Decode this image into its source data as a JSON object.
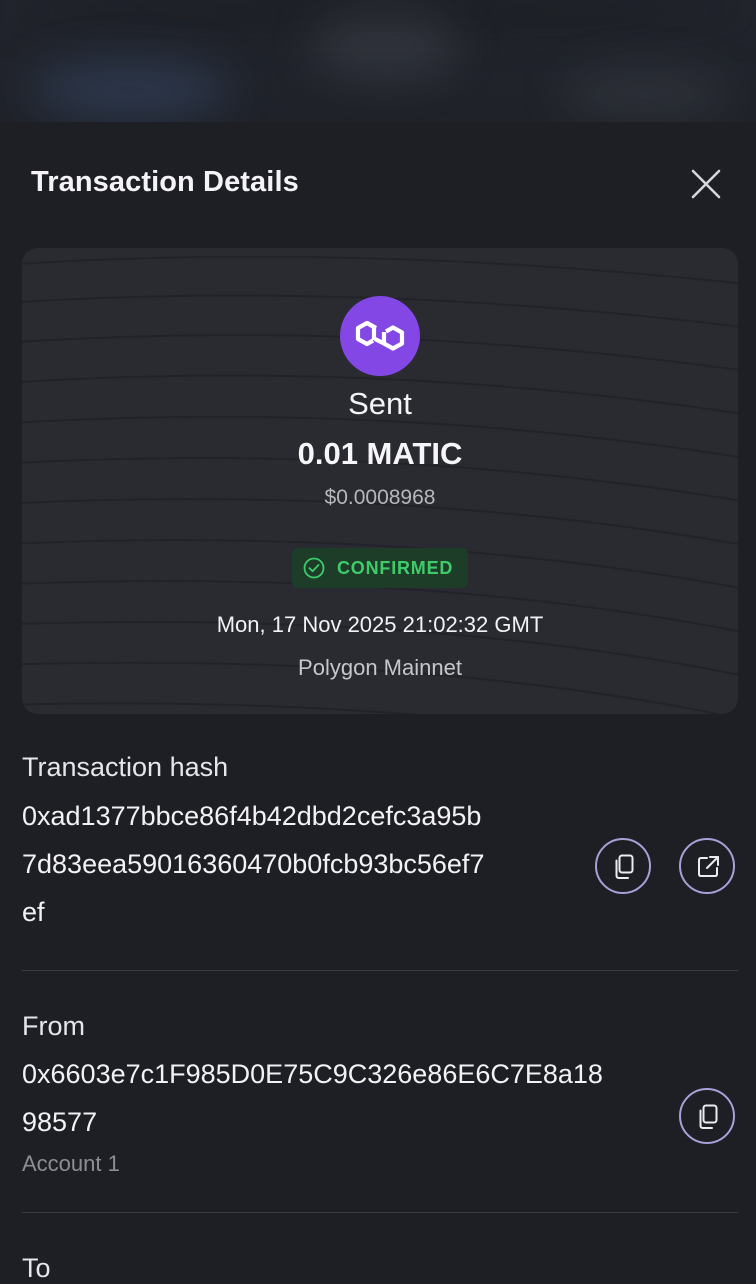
{
  "header": {
    "title": "Transaction Details"
  },
  "summary": {
    "direction": "Sent",
    "amount": "0.01 MATIC",
    "fiat_value": "$0.0008968",
    "status": "CONFIRMED",
    "timestamp": "Mon, 17 Nov 2025 21:02:32 GMT",
    "network": "Polygon Mainnet",
    "token_icon": "polygon-logo-icon"
  },
  "transaction_hash": {
    "label": "Transaction hash",
    "line1": "0xad1377bbce86f4b42dbd2cefc3a95b",
    "line2": "7d83eea59016360470b0fcb93bc56ef7",
    "line3": "ef"
  },
  "from": {
    "label": "From",
    "line1": "0x6603e7c1F985D0E75C9C326e86E6C7E8a18",
    "line2": "98577",
    "account_name": "Account 1"
  },
  "to": {
    "label": "To"
  },
  "colors": {
    "background": "#1e1f24",
    "card": "#2a2b31",
    "polygon_purple": "#8247e5",
    "confirmed_green": "#3ecc6a",
    "confirmed_bg": "#1d3d28",
    "icon_button_border": "#a9a0d8"
  }
}
